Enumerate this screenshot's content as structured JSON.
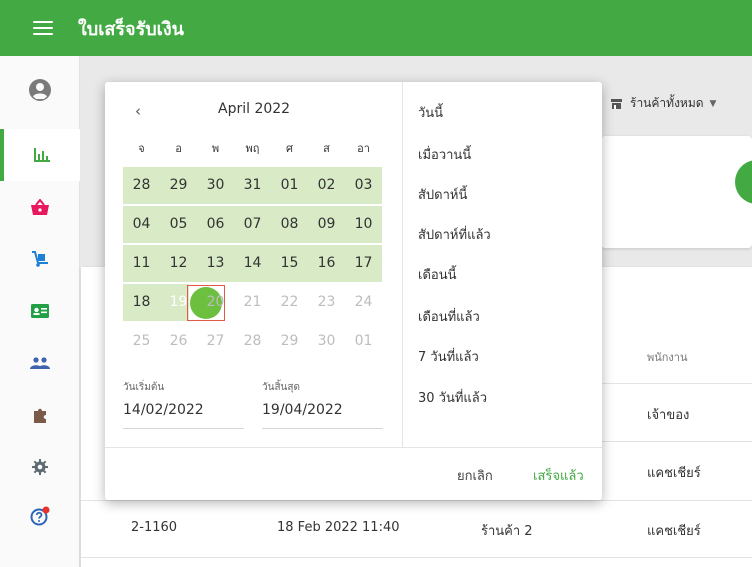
{
  "header": {
    "title": "ใบเสร็จรับเงิน",
    "bg_color": "#43a943"
  },
  "sidebar": {
    "items": [
      {
        "name": "profile",
        "icon": "account-circle-icon",
        "active": false
      },
      {
        "name": "reports",
        "icon": "bar-chart-icon",
        "active": true
      },
      {
        "name": "items",
        "icon": "basket-icon",
        "active": false
      },
      {
        "name": "inventory",
        "icon": "hand-truck-icon",
        "active": false
      },
      {
        "name": "customers",
        "icon": "contact-card-icon",
        "active": false
      },
      {
        "name": "employees",
        "icon": "people-icon",
        "active": false
      },
      {
        "name": "integrations",
        "icon": "puzzle-icon",
        "active": false
      },
      {
        "name": "settings",
        "icon": "gear-icon",
        "active": false
      },
      {
        "name": "help",
        "icon": "help-icon",
        "active": false
      }
    ]
  },
  "filters": {
    "store_label": "ร้านค้าทั้งหมด"
  },
  "table": {
    "col_employee": "พนักงาน",
    "rows": [
      {
        "receipt": "",
        "date": "",
        "store": "",
        "employee": "เจ้าของ"
      },
      {
        "receipt": "",
        "date": "",
        "store": "",
        "employee": "แคชเชียร์"
      },
      {
        "receipt": "2-1160",
        "date": "18 Feb 2022 11:40",
        "store": "ร้านค้า 2",
        "employee": "แคชเชียร์"
      }
    ]
  },
  "picker": {
    "prev_label": "‹",
    "month_label": "April 2022",
    "weekdays": [
      "จ",
      "อ",
      "พ",
      "พฤ",
      "ศ",
      "ส",
      "อา"
    ],
    "weeks": [
      [
        "28",
        "29",
        "30",
        "31",
        "01",
        "02",
        "03"
      ],
      [
        "04",
        "05",
        "06",
        "07",
        "08",
        "09",
        "10"
      ],
      [
        "11",
        "12",
        "13",
        "14",
        "15",
        "16",
        "17"
      ],
      [
        "18",
        "19",
        "20",
        "21",
        "22",
        "23",
        "24"
      ],
      [
        "25",
        "26",
        "27",
        "28",
        "29",
        "30",
        "01"
      ]
    ],
    "selected_day": "19",
    "range_color": "#d9ebc6",
    "selected_color": "#6dbf3f",
    "start_label": "วันเริ่มต้น",
    "start_value": "14/02/2022",
    "end_label": "วันสิ้นสุด",
    "end_value": "19/04/2022",
    "presets": [
      "วันนี้",
      "เมื่อวานนี้",
      "สัปดาห์นี้",
      "สัปดาห์ที่แล้ว",
      "เดือนนี้",
      "เดือนที่แล้ว",
      "7 วันที่แล้ว",
      "30 วันที่แล้ว"
    ],
    "cancel_label": "ยกเลิก",
    "done_label": "เสร็จแล้ว"
  }
}
